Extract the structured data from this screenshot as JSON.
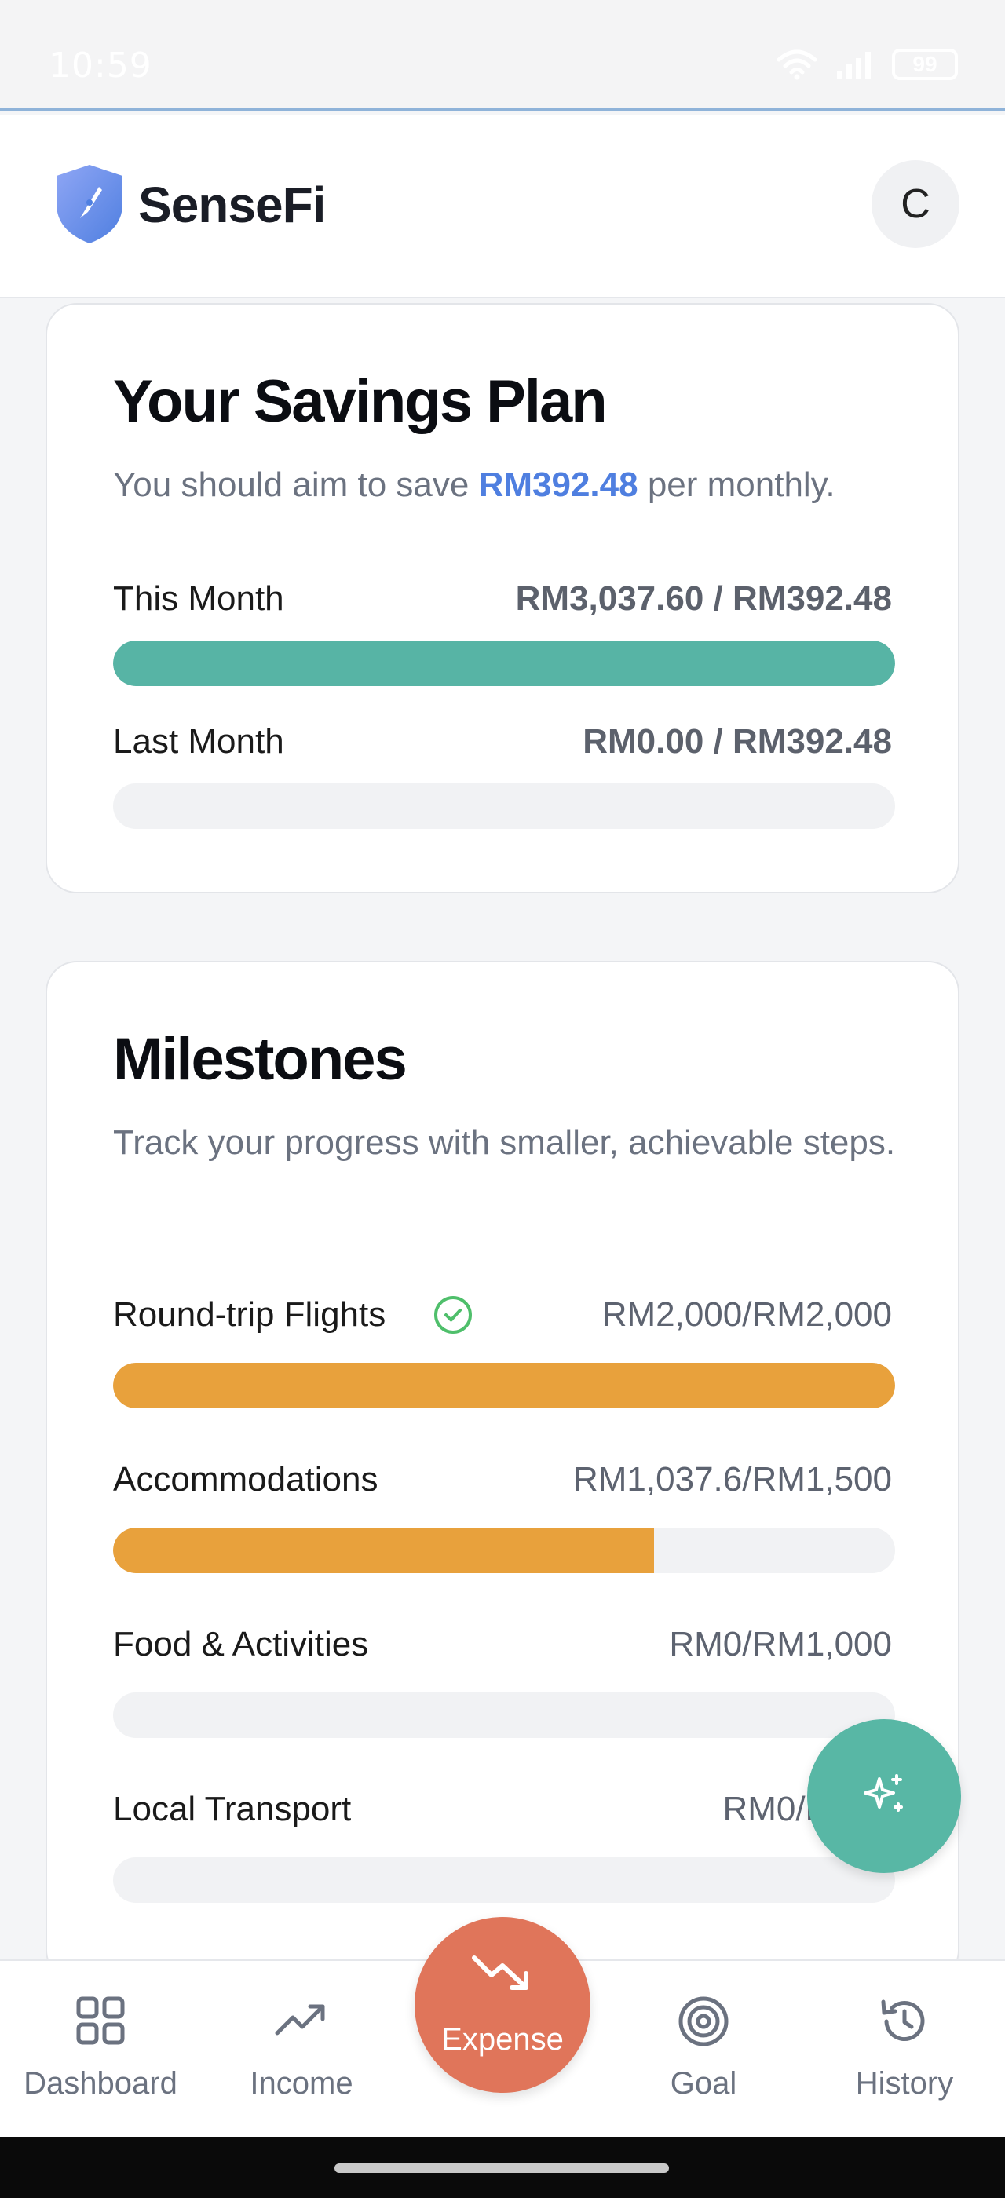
{
  "status_bar": {
    "time": "10:59",
    "battery": "99"
  },
  "header": {
    "app_name": "SenseFi",
    "avatar_initial": "C"
  },
  "savings_plan": {
    "title": "Your Savings Plan",
    "subtitle_prefix": "You should aim to save ",
    "subtitle_amount": "RM392.48",
    "subtitle_suffix": " per monthly.",
    "rows": [
      {
        "label": "This Month",
        "value": "RM3,037.60 / RM392.48",
        "progress": 1.0
      },
      {
        "label": "Last Month",
        "value": "RM0.00 / RM392.48",
        "progress": 0.0
      }
    ]
  },
  "milestones": {
    "title": "Milestones",
    "subtitle": "Track your progress with smaller, achievable steps.",
    "items": [
      {
        "label": "Round-trip Flights",
        "value": "RM2,000/RM2,000",
        "progress": 1.0,
        "completed": true
      },
      {
        "label": "Accommodations",
        "value": "RM1,037.6/RM1,500",
        "progress": 0.6917,
        "completed": false
      },
      {
        "label": "Food & Activities",
        "value": "RM0/RM1,000",
        "progress": 0.0,
        "completed": false
      },
      {
        "label": "Local Transport",
        "value": "RM0/RM",
        "progress": 0.0,
        "completed": false
      }
    ]
  },
  "fab": {
    "icon": "sparkles-icon"
  },
  "bottom_nav": {
    "dashboard": "Dashboard",
    "income": "Income",
    "expense": "Expense",
    "goal": "Goal",
    "history": "History"
  },
  "colors": {
    "accent_blue": "#4f7fe0",
    "progress_green": "#57b4a5",
    "progress_orange": "#e8a13c",
    "expense_button": "#e0755a",
    "fab": "#58b7a5"
  }
}
